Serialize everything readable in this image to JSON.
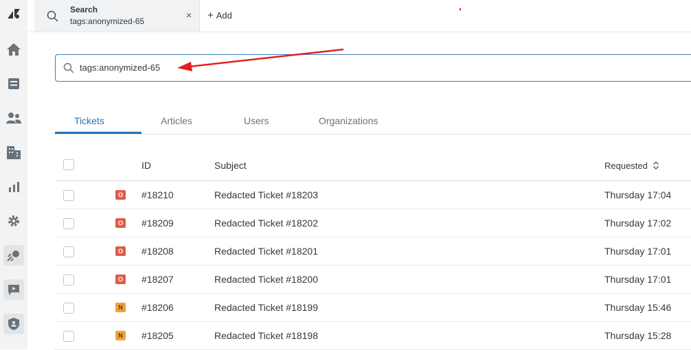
{
  "topbar": {
    "search_tab_title": "Search",
    "search_tab_subtitle": "tags:anonymized-65",
    "close_symbol": "×",
    "add_label": "Add"
  },
  "search": {
    "value": "tags:anonymized-65"
  },
  "result_tabs": [
    "Tickets",
    "Articles",
    "Users",
    "Organizations"
  ],
  "table": {
    "headers": {
      "id": "ID",
      "subject": "Subject",
      "requested": "Requested"
    },
    "rows": [
      {
        "status": "O",
        "id": "#18210",
        "subject": "Redacted Ticket #18203",
        "requested": "Thursday 17:04"
      },
      {
        "status": "O",
        "id": "#18209",
        "subject": "Redacted Ticket #18202",
        "requested": "Thursday 17:02"
      },
      {
        "status": "O",
        "id": "#18208",
        "subject": "Redacted Ticket #18201",
        "requested": "Thursday 17:01"
      },
      {
        "status": "O",
        "id": "#18207",
        "subject": "Redacted Ticket #18200",
        "requested": "Thursday 17:01"
      },
      {
        "status": "N",
        "id": "#18206",
        "subject": "Redacted Ticket #18199",
        "requested": "Thursday 15:46"
      },
      {
        "status": "N",
        "id": "#18205",
        "subject": "Redacted Ticket #18198",
        "requested": "Thursday 15:28"
      }
    ]
  },
  "colors": {
    "accent": "#1f73b7",
    "status_open": "#e35b48",
    "status_new": "#f0a33a",
    "annotation_arrow": "#e02020"
  },
  "icons": {
    "nav": [
      "zendesk-logo-icon",
      "home-icon",
      "views-icon",
      "customers-icon",
      "organizations-icon",
      "reporting-icon",
      "admin-gear-icon",
      "app-icon",
      "video-app-icon",
      "shield-app-icon"
    ]
  }
}
